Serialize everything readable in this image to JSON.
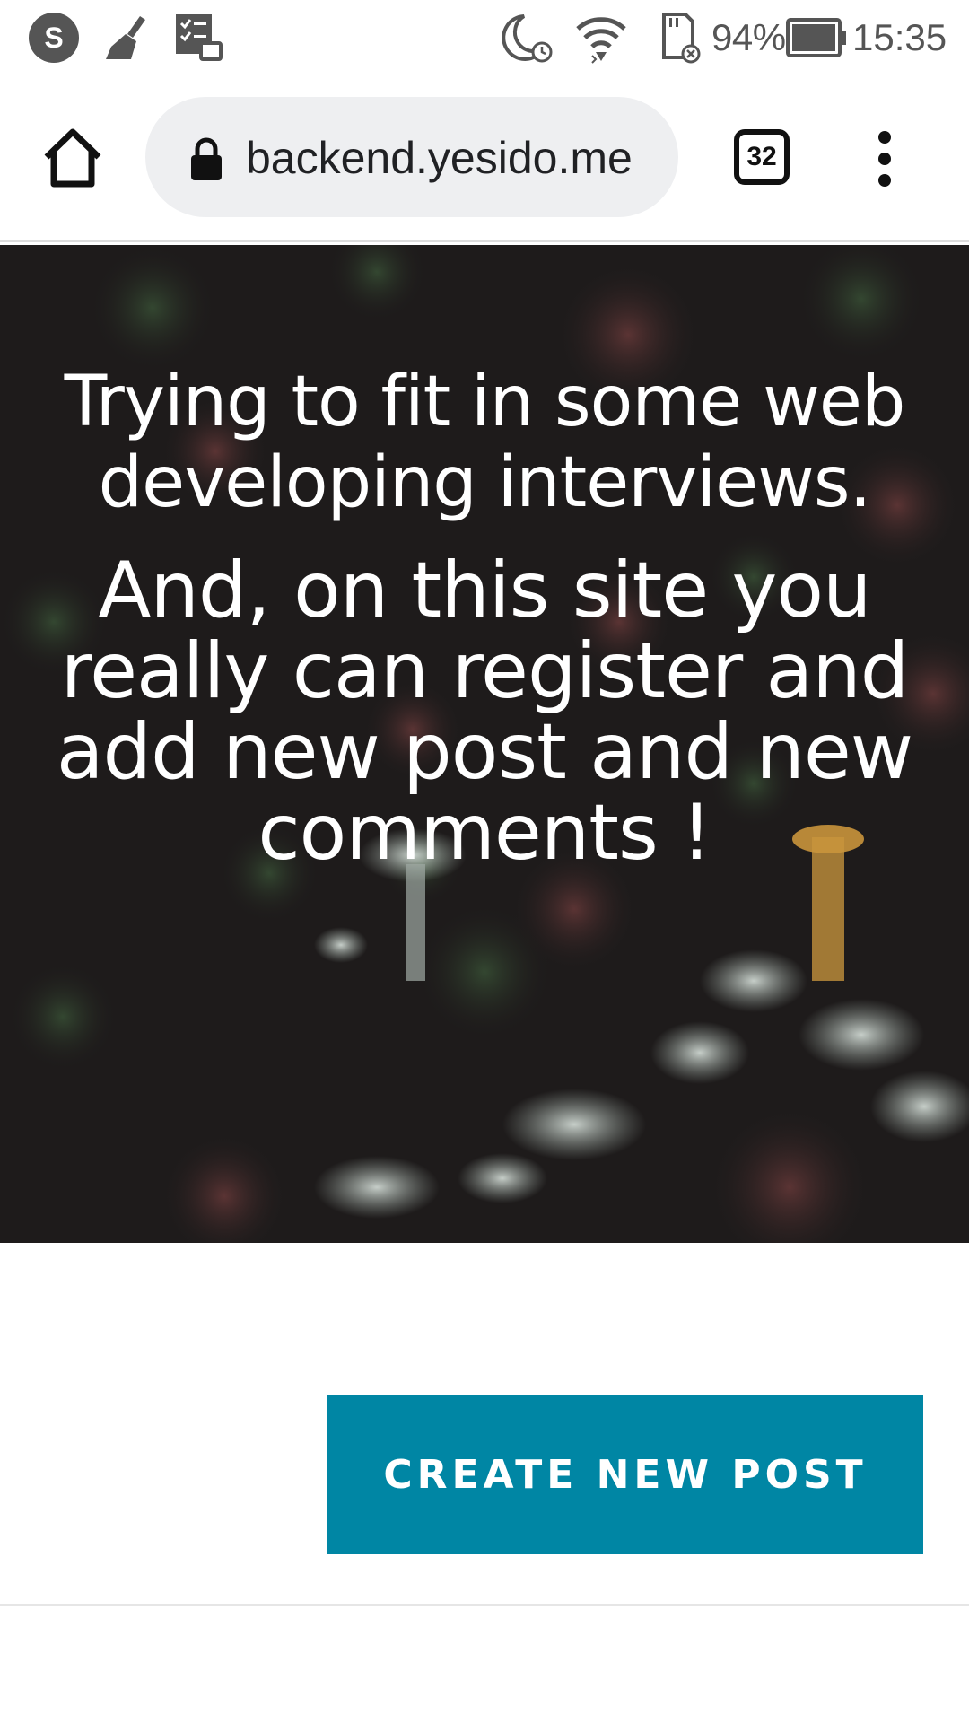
{
  "status_bar": {
    "left_icons": [
      "s-app-icon",
      "broom-icon",
      "task-list-icon"
    ],
    "right_icons": [
      "moon-alarm-icon",
      "wifi-icon",
      "sd-card-icon",
      "battery-icon"
    ],
    "battery_percent": "94%",
    "time": "15:35"
  },
  "browser": {
    "url": "backend.yesido.me",
    "tab_count": "32",
    "home_icon": "home-icon",
    "lock_icon": "lock-icon",
    "menu_icon": "more-vert-icon"
  },
  "hero": {
    "heading": "Trying to fit in some web developing interviews.",
    "subheading": "And, on this site you really can register and add new post and new comments !"
  },
  "content": {
    "create_post_label": "CREATE NEW POST"
  },
  "colors": {
    "accent": "#0086a4",
    "hero_background": "#1f1c1c",
    "omnibox_background": "#eeeff1"
  }
}
